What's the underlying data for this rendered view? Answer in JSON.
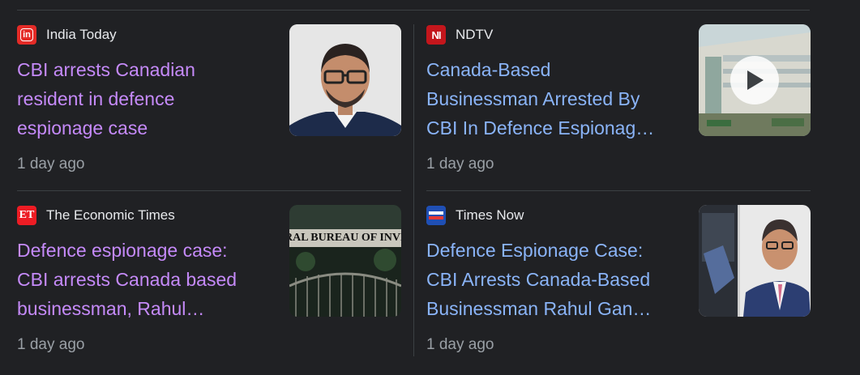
{
  "articles": [
    {
      "source": "India Today",
      "source_logo_text": "in",
      "source_color": "#e42b27",
      "headline": "CBI arrests Canadian resident in defence espionage case",
      "headline_lines": [
        "CBI arrests Canadian",
        "resident in defence",
        "espionage case"
      ],
      "time": "1 day ago",
      "thumbnail_icon": "portrait-photo-icon",
      "visited": true
    },
    {
      "source": "NDTV",
      "source_logo_text": "NI",
      "source_color": "#c4161c",
      "headline": "Canada-Based Businessman Arrested By CBI In Defence Espionag…",
      "headline_lines": [
        "Canada-Based",
        "Businessman Arrested By",
        "CBI In Defence Espionag…"
      ],
      "time": "1 day ago",
      "thumbnail_icon": "video-thumbnail-icon",
      "visited": false,
      "has_video": true
    },
    {
      "source": "The Economic Times",
      "source_logo_text": "ET",
      "source_color": "#ed1c24",
      "headline": "Defence espionage case: CBI arrests Canada based businessman, Rahul…",
      "headline_lines": [
        "Defence espionage case:",
        "CBI arrests Canada based",
        "businessman, Rahul…"
      ],
      "time": "1 day ago",
      "thumbnail_icon": "building-photo-icon",
      "thumbnail_sign": "RAL BUREAU OF INVESTI",
      "visited": true
    },
    {
      "source": "Times Now",
      "source_logo_text": "",
      "source_color": "#1f4fb4",
      "headline": "Defence Espionage Case: CBI Arrests Canada-Based Businessman Rahul Gan…",
      "headline_lines": [
        "Defence Espionage Case:",
        "CBI Arrests Canada-Based",
        "Businessman Rahul Gan…"
      ],
      "time": "1 day ago",
      "thumbnail_icon": "portrait-photo-icon",
      "visited": false
    }
  ],
  "colors": {
    "background": "#202124",
    "visited_link": "#c58af9",
    "link": "#8ab4f8",
    "meta_text": "#9aa0a6"
  }
}
